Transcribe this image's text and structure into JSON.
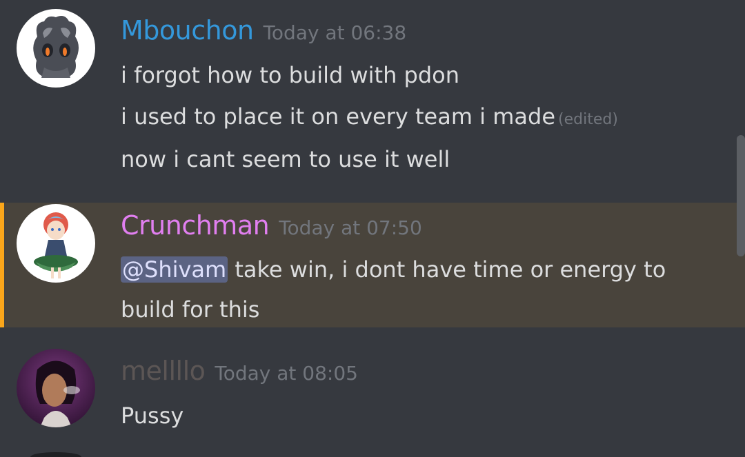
{
  "messages": [
    {
      "username": "Mbouchon",
      "username_color": "#3498db",
      "timestamp": "Today at 06:38",
      "avatar": "marshadow-avatar",
      "lines": [
        {
          "text": "i forgot how to build with pdon"
        },
        {
          "text": "i used to place it on every team i made",
          "edited": "(edited)"
        },
        {
          "text": "now i cant seem to use it well"
        }
      ]
    },
    {
      "username": "Crunchman",
      "username_color": "#e17ff0",
      "timestamp": "Today at 07:50",
      "avatar": "anime-character-avatar",
      "mention": "@Shivam",
      "lines": [
        {
          "text": " take win, i dont have time or energy to"
        },
        {
          "text": "build for this"
        }
      ],
      "highlighted": true,
      "highlight_color": "#faa61a"
    },
    {
      "username": "mellllo",
      "username_color": "#5c5655",
      "timestamp": "Today at 08:05",
      "avatar": "profile-photo-avatar",
      "lines": [
        {
          "text": "Pussy"
        }
      ]
    }
  ]
}
